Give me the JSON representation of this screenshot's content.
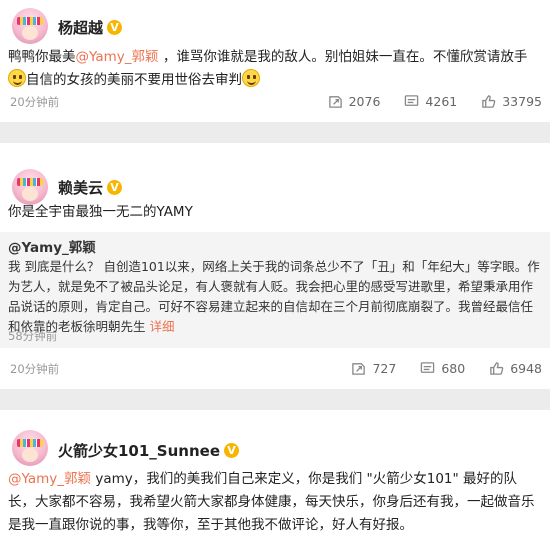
{
  "posts": [
    {
      "author": "杨超越",
      "verified_badge": "V",
      "text_parts": [
        "鸭鸭你最美",
        "@Yamy_郭颖",
        " ，谁骂你谁就是我的敌人。别怕姐妹一直在。不懂欣赏请放手",
        "自信的女孩的美丽不要用世俗去审判"
      ],
      "time": "20分钟前",
      "reposts": "2076",
      "comments": "4261",
      "likes": "33795"
    },
    {
      "author": "赖美云",
      "verified_badge": "V",
      "text": "你是全宇宙最独一无二的YAMY",
      "quoted": {
        "author": "@Yamy_郭颖",
        "text": "我 到底是什么？      自创造101以来，网络上关于我的词条总少不了「丑」和「年纪大」等字眼。作为艺人，就是免不了被品头论足，有人褒就有人贬。我会把心里的感受写进歌里，希望秉承用作品说话的原则，肯定自己。可好不容易建立起来的自信却在三个月前彻底崩裂了。我曾经最信任和依靠的老板徐明朝先生",
        "more": "详细",
        "time": "58分钟前"
      },
      "time": "20分钟前",
      "reposts": "727",
      "comments": "680",
      "likes": "6948"
    },
    {
      "author": "火箭少女101_Sunnee",
      "verified_badge": "V",
      "mention": "@Yamy_郭颖",
      "text": " yamy，我们的美我们自己来定义，你是我们 \"火箭少女101\" 最好的队长，大家都不容易，我希望火箭大家都身体健康，每天快乐，你身后还有我，一起做音乐是我一直跟你说的事，我等你，至于其他我不做评论，好人有好报。"
    }
  ],
  "icons": [
    "repost-icon",
    "comment-icon",
    "like-icon",
    "smile-emoji-icon",
    "verified-badge-icon"
  ],
  "colors": {
    "mention": "#eb7350",
    "badge": "#f7b500",
    "meta": "#999999"
  }
}
